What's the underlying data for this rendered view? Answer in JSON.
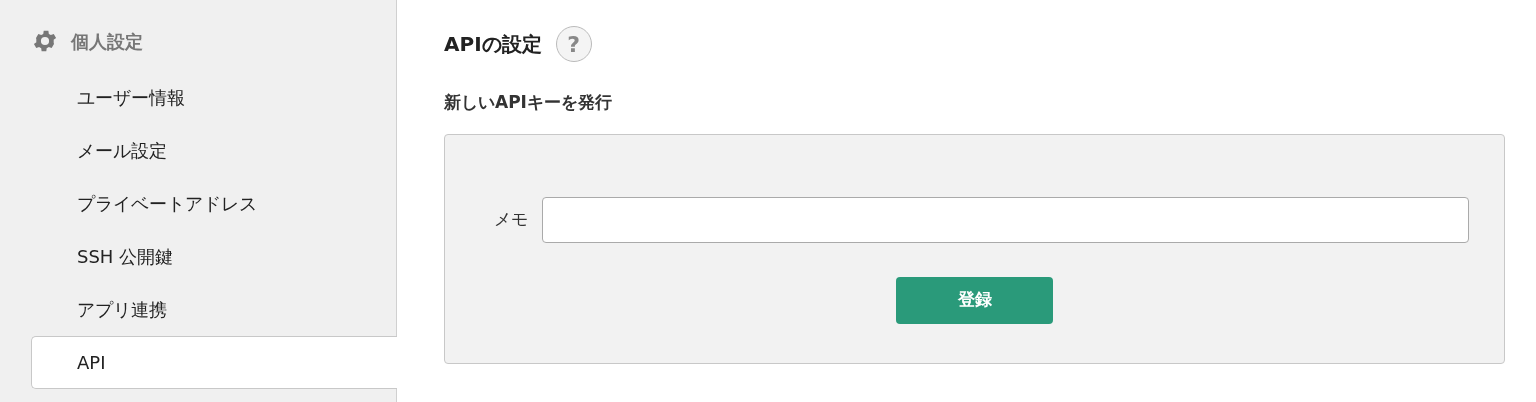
{
  "sidebar": {
    "header": "個人設定",
    "items": [
      {
        "label": "ユーザー情報",
        "selected": false
      },
      {
        "label": "メール設定",
        "selected": false
      },
      {
        "label": "プライベートアドレス",
        "selected": false
      },
      {
        "label": "SSH 公開鍵",
        "selected": false
      },
      {
        "label": "アプリ連携",
        "selected": false
      },
      {
        "label": "API",
        "selected": true
      }
    ]
  },
  "main": {
    "title": "APIの設定",
    "help": "?",
    "section": "新しいAPIキーを発行",
    "form": {
      "memo_label": "メモ",
      "submit": "登録"
    }
  }
}
